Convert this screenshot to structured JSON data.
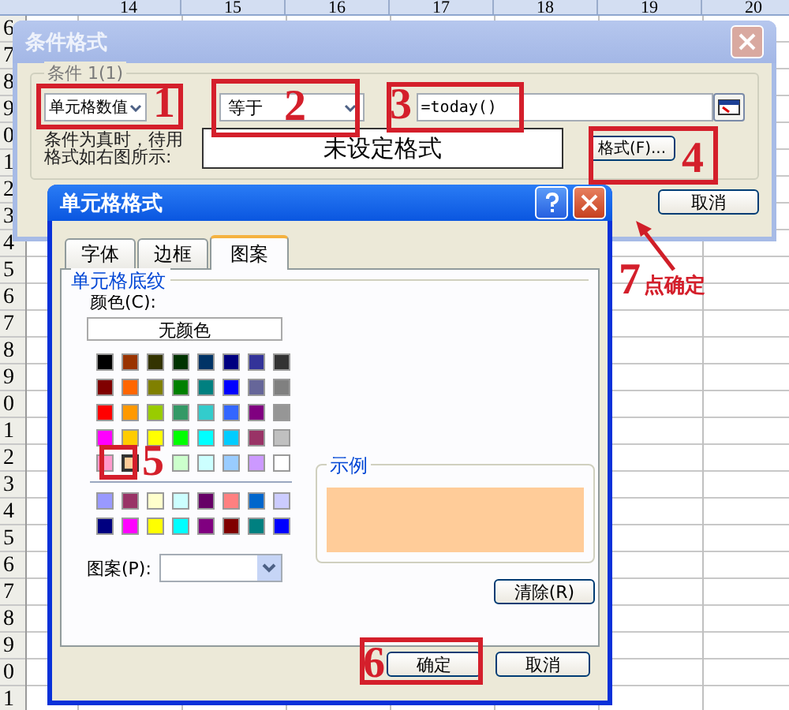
{
  "sheet": {
    "column_headers": [
      "14",
      "15",
      "16",
      "17",
      "18",
      "19",
      "20"
    ],
    "row_headers": [
      "6",
      "7",
      "8",
      "9",
      "0",
      "1",
      "2",
      "3",
      "4",
      "5",
      "6",
      "7",
      "8",
      "9",
      "0",
      "1",
      "2",
      "3",
      "4",
      "5",
      "6",
      "7",
      "8",
      "9",
      "0",
      "1"
    ]
  },
  "condition_dialog": {
    "title": "条件格式",
    "group_label": "条件 1(1)",
    "operand_type": "单元格数值",
    "operator": "等于",
    "formula": "=today()",
    "preview_caption": "条件为真时，待用格式如右图所示:",
    "preview_text": "未设定格式",
    "format_button": "格式(F)...",
    "cancel_button": "取消"
  },
  "cell_format_dialog": {
    "title": "单元格格式",
    "tabs": [
      {
        "label": "字体",
        "selected": false
      },
      {
        "label": "边框",
        "selected": false
      },
      {
        "label": "图案",
        "selected": true
      }
    ],
    "group_label": "单元格底纹",
    "color_label": "颜色(C):",
    "no_color_button": "无颜色",
    "palette": [
      [
        {
          "color": "#000000",
          "selected": false
        },
        {
          "color": "#993300",
          "selected": false
        },
        {
          "color": "#333300",
          "selected": false
        },
        {
          "color": "#003300",
          "selected": false
        },
        {
          "color": "#003366",
          "selected": false
        },
        {
          "color": "#000080",
          "selected": false
        },
        {
          "color": "#333399",
          "selected": false
        },
        {
          "color": "#333333",
          "selected": false
        }
      ],
      [
        {
          "color": "#800000",
          "selected": false
        },
        {
          "color": "#ff6600",
          "selected": false
        },
        {
          "color": "#808000",
          "selected": false
        },
        {
          "color": "#008000",
          "selected": false
        },
        {
          "color": "#008080",
          "selected": false
        },
        {
          "color": "#0000ff",
          "selected": false
        },
        {
          "color": "#666699",
          "selected": false
        },
        {
          "color": "#808080",
          "selected": false
        }
      ],
      [
        {
          "color": "#ff0000",
          "selected": false
        },
        {
          "color": "#ff9900",
          "selected": false
        },
        {
          "color": "#99cc00",
          "selected": false
        },
        {
          "color": "#339966",
          "selected": false
        },
        {
          "color": "#33cccc",
          "selected": false
        },
        {
          "color": "#3366ff",
          "selected": false
        },
        {
          "color": "#800080",
          "selected": false
        },
        {
          "color": "#969696",
          "selected": false
        }
      ],
      [
        {
          "color": "#ff00ff",
          "selected": false
        },
        {
          "color": "#ffcc00",
          "selected": false
        },
        {
          "color": "#ffff00",
          "selected": false
        },
        {
          "color": "#00ff00",
          "selected": false
        },
        {
          "color": "#00ffff",
          "selected": false
        },
        {
          "color": "#00ccff",
          "selected": false
        },
        {
          "color": "#993366",
          "selected": false
        },
        {
          "color": "#c0c0c0",
          "selected": false
        }
      ],
      [
        {
          "color": "#ff99cc",
          "selected": false
        },
        {
          "color": "#ffcc99",
          "selected": true
        },
        {
          "kind": "covered"
        },
        {
          "color": "#ccffcc",
          "selected": false
        },
        {
          "color": "#ccffff",
          "selected": false
        },
        {
          "color": "#99ccff",
          "selected": false
        },
        {
          "color": "#cc99ff",
          "selected": false
        },
        {
          "color": "#ffffff",
          "selected": false
        }
      ],
      [
        {
          "color": "#9999ff",
          "selected": false
        },
        {
          "color": "#993366",
          "selected": false
        },
        {
          "color": "#ffffcc",
          "selected": false
        },
        {
          "color": "#ccffff",
          "selected": false
        },
        {
          "color": "#660066",
          "selected": false
        },
        {
          "color": "#ff8080",
          "selected": false
        },
        {
          "color": "#0066cc",
          "selected": false
        },
        {
          "color": "#ccccff",
          "selected": false
        }
      ],
      [
        {
          "color": "#000080",
          "selected": false
        },
        {
          "color": "#ff00ff",
          "selected": false
        },
        {
          "color": "#ffff00",
          "selected": false
        },
        {
          "color": "#00ffff",
          "selected": false
        },
        {
          "color": "#800080",
          "selected": false
        },
        {
          "color": "#800000",
          "selected": false
        },
        {
          "color": "#008080",
          "selected": false
        },
        {
          "color": "#0000ff",
          "selected": false
        }
      ]
    ],
    "pattern_label": "图案(P):",
    "sample_label": "示例",
    "clear_button": "清除(R)",
    "ok_button": "确定",
    "cancel_button": "取消"
  },
  "annotations": [
    {
      "kind": "step",
      "number": "1"
    },
    {
      "kind": "step",
      "number": "2"
    },
    {
      "kind": "step",
      "number": "3"
    },
    {
      "kind": "step",
      "number": "4"
    },
    {
      "kind": "step",
      "number": "5"
    },
    {
      "kind": "step",
      "number": "6"
    },
    {
      "kind": "note",
      "number": "7",
      "text": "点确定"
    }
  ]
}
